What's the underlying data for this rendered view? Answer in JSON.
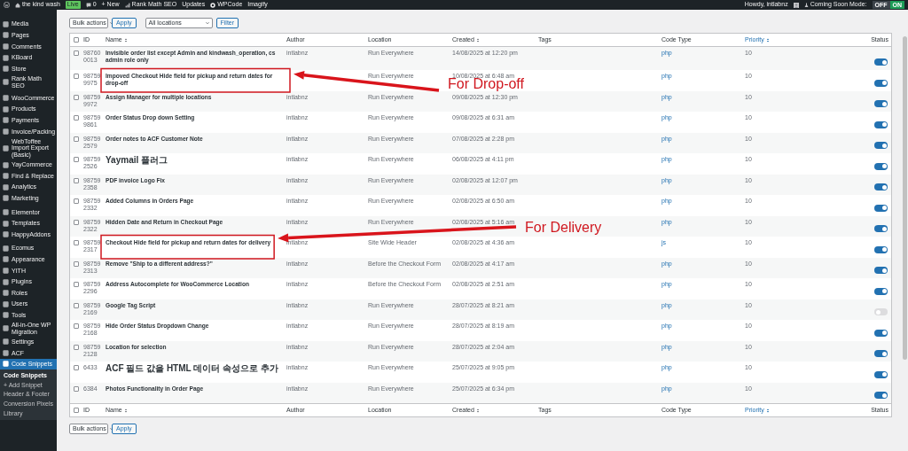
{
  "admin_bar": {
    "site": "the kind wash",
    "site_badge": "Live",
    "comments": "0",
    "new": "+ New",
    "items": [
      {
        "label": "Rank Math SEO",
        "kind": "chart"
      },
      {
        "label": "Updates",
        "kind": "plain"
      },
      {
        "label": "WPCode",
        "kind": "logo"
      },
      {
        "label": "Imagify",
        "kind": "plain"
      }
    ],
    "greeting": "Howdy, intlabnz",
    "coming_soon": {
      "label": "Coming Soon Mode:",
      "options": [
        {
          "label": "OFF",
          "selected": false
        },
        {
          "label": "ON",
          "selected": true
        }
      ]
    }
  },
  "sidebar": {
    "groups": [
      {
        "items": [
          {
            "label": "Media"
          },
          {
            "label": "Pages"
          },
          {
            "label": "Comments"
          },
          {
            "label": "KBoard"
          },
          {
            "label": "Store"
          },
          {
            "label": "Rank Math SEO"
          }
        ]
      },
      {
        "items": [
          {
            "label": "WooCommerce"
          },
          {
            "label": "Products"
          },
          {
            "label": "Payments"
          },
          {
            "label": "Invoice/Packing"
          },
          {
            "label": "WebToffee Import Export (Basic)"
          },
          {
            "label": "YayCommerce"
          },
          {
            "label": "Find & Replace"
          },
          {
            "label": "Analytics"
          },
          {
            "label": "Marketing"
          }
        ]
      },
      {
        "items": [
          {
            "label": "Elementor"
          },
          {
            "label": "Templates"
          },
          {
            "label": "HappyAddons"
          }
        ]
      },
      {
        "items": [
          {
            "label": "Ecomus"
          },
          {
            "label": "Appearance"
          },
          {
            "label": "YITH"
          },
          {
            "label": "Plugins"
          },
          {
            "label": "Roles"
          },
          {
            "label": "Users"
          },
          {
            "label": "Tools"
          },
          {
            "label": "All-in-One WP Migration"
          },
          {
            "label": "Settings"
          },
          {
            "label": "ACF"
          },
          {
            "label": "Code Snippets",
            "selected": true,
            "children": [
              {
                "label": "Code Snippets",
                "selected": true
              },
              {
                "label": "+ Add Snippet",
                "selected": false
              },
              {
                "label": "Header & Footer",
                "selected": false
              },
              {
                "label": "Conversion Pixels",
                "selected": false
              },
              {
                "label": "Library",
                "selected": false
              }
            ]
          }
        ]
      }
    ]
  },
  "toolbar_top": {
    "bulk_actions": "Bulk actions",
    "apply": "Apply",
    "location_filter": "All locations",
    "filter": "Filter"
  },
  "table": {
    "select_all_checked": false,
    "header_columns": [
      {
        "label": "ID",
        "sortable": false,
        "sorted": false
      },
      {
        "label": "Name",
        "sortable": true,
        "sorted": false
      },
      {
        "label": "Author",
        "sortable": false,
        "sorted": false
      },
      {
        "label": "Location",
        "sortable": false,
        "sorted": false
      },
      {
        "label": "Created",
        "sortable": true,
        "sorted": false
      },
      {
        "label": "Tags",
        "sortable": false,
        "sorted": false
      },
      {
        "label": "Code Type",
        "sortable": false,
        "sorted": false
      },
      {
        "label": "Priority",
        "sortable": true,
        "sorted": true
      },
      {
        "label": "Status",
        "sortable": false,
        "sorted": false
      }
    ],
    "rows": [
      {
        "id": "987600013",
        "name": "Invisible order list except Admin and kindwash_operation, cs admin role only",
        "author": "intlabnz",
        "location": "Run Everywhere",
        "created": "14/08/2025 at 12:20 pm",
        "code_type": "php",
        "priority": "10",
        "active": true,
        "checked": false,
        "highlighted": false
      },
      {
        "id": "987599975",
        "name": "Impoved Checkout Hide field for pickup and return dates for drop-off",
        "location": "Run Everywhere",
        "created": "10/08/2025 at 6:48 am",
        "code_type": "php",
        "priority": "10",
        "active": true,
        "checked": false,
        "highlighted": true,
        "callout": "For Drop-off"
      },
      {
        "id": "987599972",
        "name": "Assign Manager for multiple locations",
        "author": "intlabnz",
        "location": "Run Everywhere",
        "created": "09/08/2025 at 12:30 pm",
        "code_type": "php",
        "priority": "10",
        "active": true,
        "checked": false,
        "highlighted": false
      },
      {
        "id": "987599861",
        "name": "Order Status Drop down Setting",
        "author": "intlabnz",
        "location": "Run Everywhere",
        "created": "09/08/2025 at 6:31 am",
        "code_type": "php",
        "priority": "10",
        "active": true,
        "checked": false,
        "highlighted": false
      },
      {
        "id": "987592579",
        "name": "Order notes to ACF Customer Note",
        "author": "intlabnz",
        "location": "Run Everywhere",
        "created": "07/08/2025 at 2:28 pm",
        "code_type": "php",
        "priority": "10",
        "active": true,
        "checked": false,
        "highlighted": false
      },
      {
        "id": "987592526",
        "name": "Yaymail 플러그",
        "author": "intlabnz",
        "location": "Run Everywhere",
        "created": "06/08/2025 at 4:11 pm",
        "code_type": "php",
        "priority": "10",
        "active": true,
        "checked": false,
        "highlighted": false
      },
      {
        "id": "987592358",
        "name": "PDF invoice Logo Fix",
        "author": "intlabnz",
        "location": "Run Everywhere",
        "created": "02/08/2025 at 12:07 pm",
        "code_type": "php",
        "priority": "10",
        "active": true,
        "checked": false,
        "highlighted": false
      },
      {
        "id": "987592332",
        "name": "Added Columns in Orders Page",
        "author": "intlabnz",
        "location": "Run Everywhere",
        "created": "02/08/2025 at 6:50 am",
        "code_type": "php",
        "priority": "10",
        "active": true,
        "checked": false,
        "highlighted": false
      },
      {
        "id": "987592322",
        "name": "Hidden Date and Return in Checkout Page",
        "author": "intlabnz",
        "location": "Run Everywhere",
        "created": "02/08/2025 at 5:16 am",
        "code_type": "php",
        "priority": "10",
        "active": true,
        "checked": false,
        "highlighted": false
      },
      {
        "id": "987592317",
        "name": "Checkout Hide field for pickup and return dates for delivery",
        "author": "intlabnz",
        "location": "Site Wide Header",
        "created": "02/08/2025 at 4:36 am",
        "code_type": "js",
        "priority": "10",
        "active": true,
        "checked": false,
        "highlighted": true,
        "callout": "For Delivery"
      },
      {
        "id": "987592313",
        "name": "Remove \"Ship to a different address?\"",
        "author": "intlabnz",
        "location": "Before the Checkout Form",
        "created": "02/08/2025 at 4:17 am",
        "code_type": "php",
        "priority": "10",
        "active": true,
        "checked": false,
        "highlighted": false
      },
      {
        "id": "987592296",
        "name": "Address Autocomplete for WooCommerce Location",
        "author": "intlabnz",
        "location": "Before the Checkout Form",
        "created": "02/08/2025 at 2:51 am",
        "code_type": "php",
        "priority": "10",
        "active": true,
        "checked": false,
        "highlighted": false
      },
      {
        "id": "987592169",
        "name": "Google Tag Script",
        "author": "intlabnz",
        "location": "Run Everywhere",
        "created": "28/07/2025 at 8:21 am",
        "code_type": "php",
        "priority": "10",
        "active": false,
        "checked": false,
        "highlighted": false
      },
      {
        "id": "987592168",
        "name": "Hide Order Status Dropdown Change",
        "author": "intlabnz",
        "location": "Run Everywhere",
        "created": "28/07/2025 at 8:19 am",
        "code_type": "php",
        "priority": "10",
        "active": true,
        "checked": false,
        "highlighted": false
      },
      {
        "id": "987592128",
        "name": "Location for selection",
        "author": "intlabnz",
        "location": "Run Everywhere",
        "created": "28/07/2025 at 2:04 am",
        "code_type": "php",
        "priority": "10",
        "active": true,
        "checked": false,
        "highlighted": false
      },
      {
        "id": "6433",
        "name": "ACF 필드 값을 HTML 데이터 속성으로 추가",
        "author": "intlabnz",
        "location": "Run Everywhere",
        "created": "25/07/2025 at 9:05 pm",
        "code_type": "php",
        "priority": "10",
        "active": true,
        "checked": false,
        "highlighted": false
      },
      {
        "id": "6384",
        "name": "Photos Functionality in Order Page",
        "author": "intlabnz",
        "location": "Run Everywhere",
        "created": "25/07/2025 at 6:34 pm",
        "code_type": "php",
        "priority": "10",
        "active": true,
        "checked": false,
        "highlighted": false
      }
    ],
    "footer_select_all_checked": false,
    "footer_columns": [
      {
        "label": "ID",
        "sortable": false,
        "sorted": false
      },
      {
        "label": "Name",
        "sortable": true,
        "sorted": false
      },
      {
        "label": "Author",
        "sortable": false,
        "sorted": false
      },
      {
        "label": "Location",
        "sortable": false,
        "sorted": false
      },
      {
        "label": "Created",
        "sortable": true,
        "sorted": false
      },
      {
        "label": "Tags",
        "sortable": false,
        "sorted": false
      },
      {
        "label": "Code Type",
        "sortable": false,
        "sorted": false
      },
      {
        "label": "Priority",
        "sortable": true,
        "sorted": true
      },
      {
        "label": "Status",
        "sortable": false,
        "sorted": false
      }
    ]
  },
  "toolbar_bottom": {
    "bulk_actions": "Bulk actions",
    "apply": "Apply"
  }
}
